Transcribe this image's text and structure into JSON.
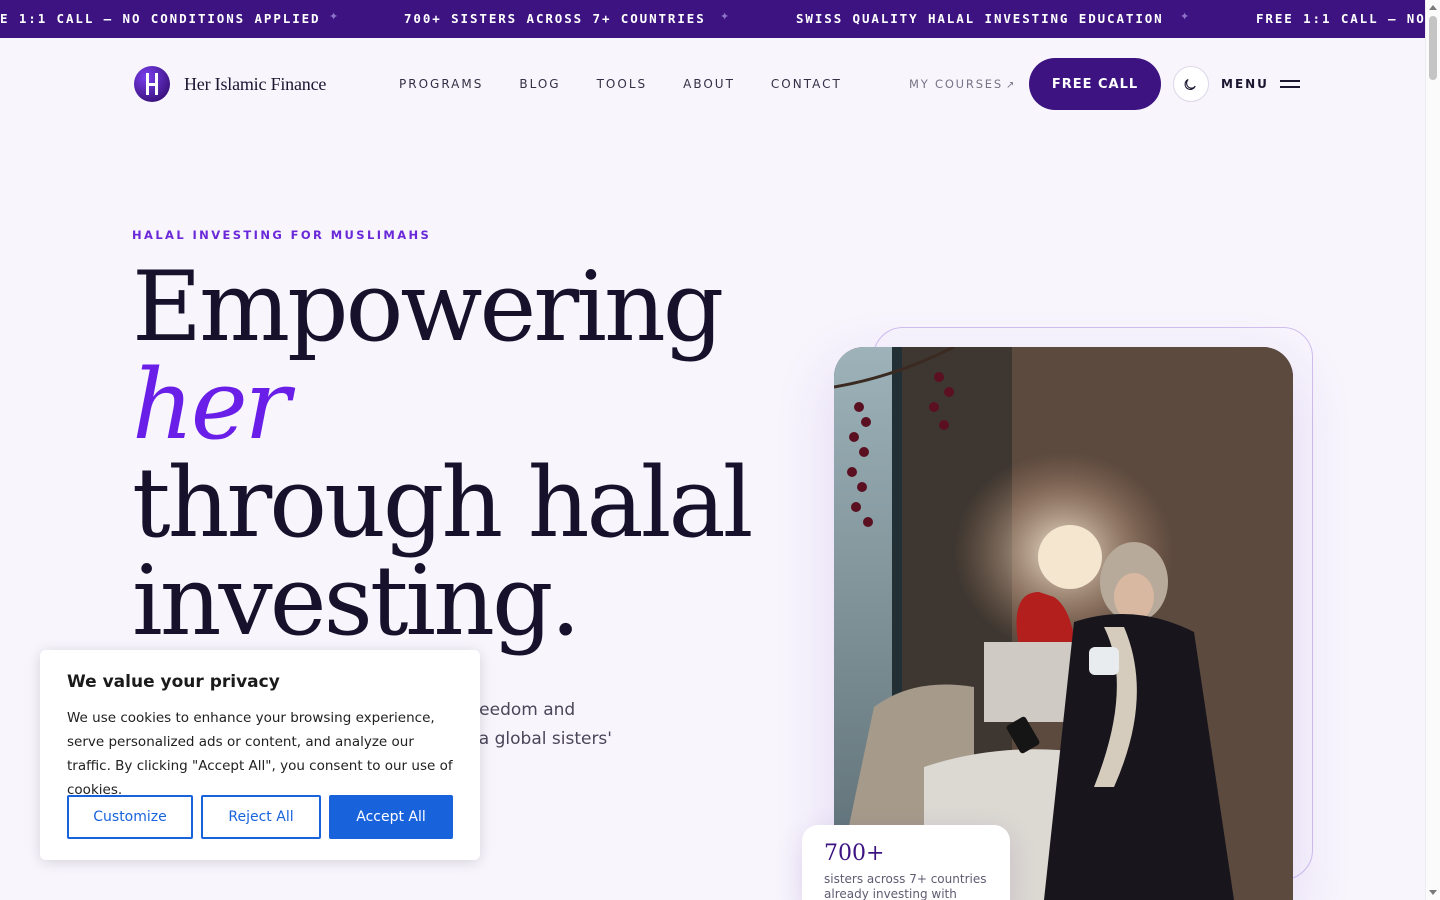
{
  "ticker": {
    "items": [
      "E 1:1 CALL — NO CONDITIONS APPLIED",
      "700+ SISTERS ACROSS 7+ COUNTRIES",
      "SWISS QUALITY HALAL INVESTING EDUCATION",
      "FREE 1:1 CALL — NO C"
    ],
    "separator": "✦"
  },
  "nav": {
    "logo_text": "Her Islamic Finance",
    "links": [
      "PROGRAMS",
      "BLOG",
      "TOOLS",
      "ABOUT",
      "CONTACT"
    ],
    "my_courses": "MY COURSES",
    "my_courses_arrow": "↗",
    "cta": "FREE CALL",
    "menu_label": "MENU"
  },
  "hero": {
    "eyebrow": "HALAL INVESTING FOR MUSLIMAHS",
    "headline": {
      "line1": "Empowering",
      "accent": "her",
      "line3": "through halal",
      "line4": "investing."
    },
    "body_line1_visible": "al freedom and",
    "body_line2_visible": ", a global sisters'"
  },
  "stat_card": {
    "number": "700+",
    "text": "sisters across 7+ countries already investing with"
  },
  "cookie": {
    "title": "We value your privacy",
    "text": "We use cookies to enhance your browsing experience, serve personalized ads or content, and analyze our traffic. By clicking \"Accept All\", you consent to our use of cookies.",
    "customize": "Customize",
    "reject": "Reject All",
    "accept": "Accept All"
  },
  "colors": {
    "brand_purple": "#3c1380",
    "accent_violet": "#6a1fe8",
    "cookie_blue": "#1863dc"
  }
}
